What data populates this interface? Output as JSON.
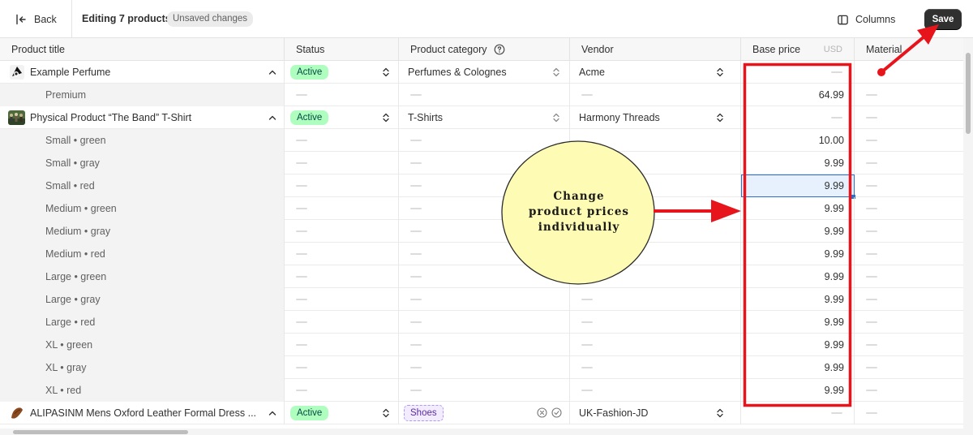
{
  "topbar": {
    "back_label": "Back",
    "title": "Editing 7 products",
    "unsaved_label": "Unsaved changes",
    "columns_label": "Columns",
    "save_label": "Save"
  },
  "headers": {
    "product_title": "Product title",
    "status": "Status",
    "category": "Product category",
    "vendor": "Vendor",
    "base_price": "Base price",
    "currency": "USD",
    "material": "Material"
  },
  "products": {
    "perfume": {
      "title": "Example Perfume",
      "status": "Active",
      "category": "Perfumes & Colognes",
      "vendor": "Acme"
    },
    "perfume_variant": {
      "title": "Premium",
      "price": "64.99"
    },
    "tshirt": {
      "title": "Physical Product “The Band” T-Shirt",
      "status": "Active",
      "category": "T-Shirts",
      "vendor": "Harmony Threads"
    },
    "tshirt_variants": [
      {
        "title": "Small • green",
        "price": "10.00"
      },
      {
        "title": "Small • gray",
        "price": "9.99"
      },
      {
        "title": "Small • red",
        "price": "9.99"
      },
      {
        "title": "Medium • green",
        "price": "9.99"
      },
      {
        "title": "Medium • gray",
        "price": "9.99"
      },
      {
        "title": "Medium • red",
        "price": "9.99"
      },
      {
        "title": "Large • green",
        "price": "9.99"
      },
      {
        "title": "Large • gray",
        "price": "9.99"
      },
      {
        "title": "Large • red",
        "price": "9.99"
      },
      {
        "title": "XL • green",
        "price": "9.99"
      },
      {
        "title": "XL • gray",
        "price": "9.99"
      },
      {
        "title": "XL • red",
        "price": "9.99"
      }
    ],
    "shoes": {
      "title": "ALIPASINM Mens Oxford Leather Formal Dress ...",
      "status": "Active",
      "category": "Shoes",
      "vendor": "UK-Fashion-JD"
    }
  },
  "annotation": {
    "callout_line1": "Change",
    "callout_line2": "product prices",
    "callout_line3": "individually",
    "highlight_color": "#e8141b",
    "callout_fill": "#fdfbb4"
  },
  "icons": [
    "back-arrow-icon",
    "columns-icon",
    "help-circle-icon",
    "chevron-up-icon",
    "select-arrows-icon",
    "x-circle-icon",
    "check-circle-icon"
  ]
}
